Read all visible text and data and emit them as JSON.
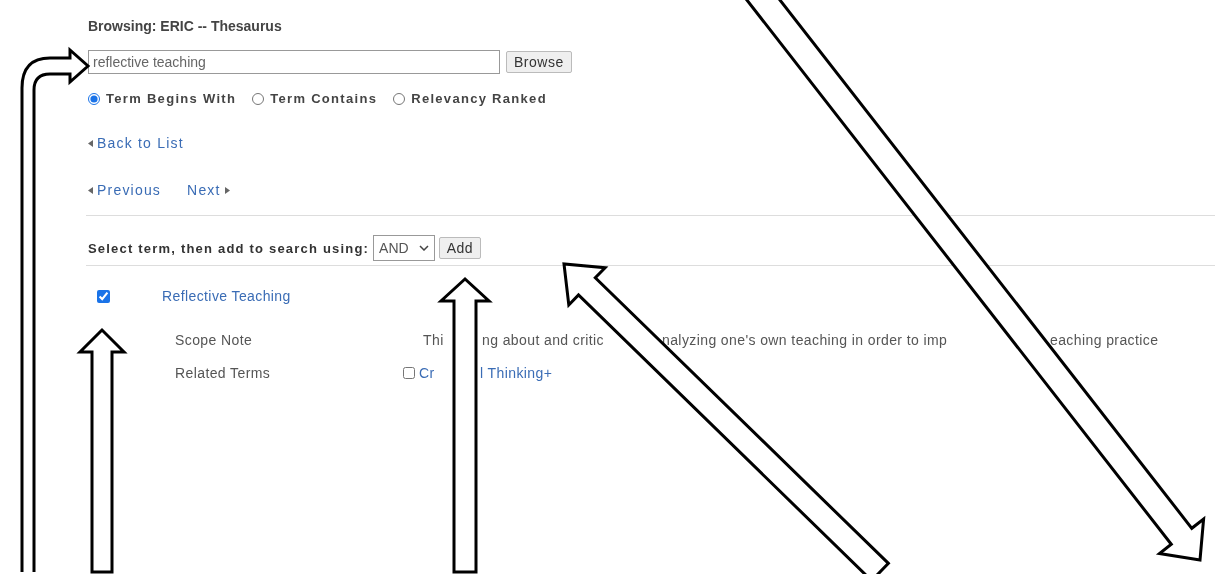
{
  "header": {
    "title": "Browsing: ERIC -- Thesaurus"
  },
  "search": {
    "value": "reflective teaching",
    "button": "Browse"
  },
  "match_options": [
    {
      "label": "Term Begins With",
      "selected": true
    },
    {
      "label": "Term Contains",
      "selected": false
    },
    {
      "label": "Relevancy Ranked",
      "selected": false
    }
  ],
  "navigation": {
    "back": "Back to List",
    "previous": "Previous",
    "next": "Next"
  },
  "add_bar": {
    "label": "Select term, then add to search using:",
    "operator": "AND",
    "button": "Add"
  },
  "term": {
    "name": "Reflective Teaching",
    "checked": true,
    "fields": [
      {
        "kind": "text",
        "label": "Scope Note",
        "value_parts": [
          "Thi",
          "ng about and critic",
          "nalyzing one's own teaching in order to imp",
          "eaching practice"
        ]
      },
      {
        "kind": "terms",
        "label": "Related Terms",
        "terms": [
          {
            "name_parts": [
              "Cr",
              "l Thinking+"
            ],
            "checked": false
          }
        ]
      }
    ]
  }
}
